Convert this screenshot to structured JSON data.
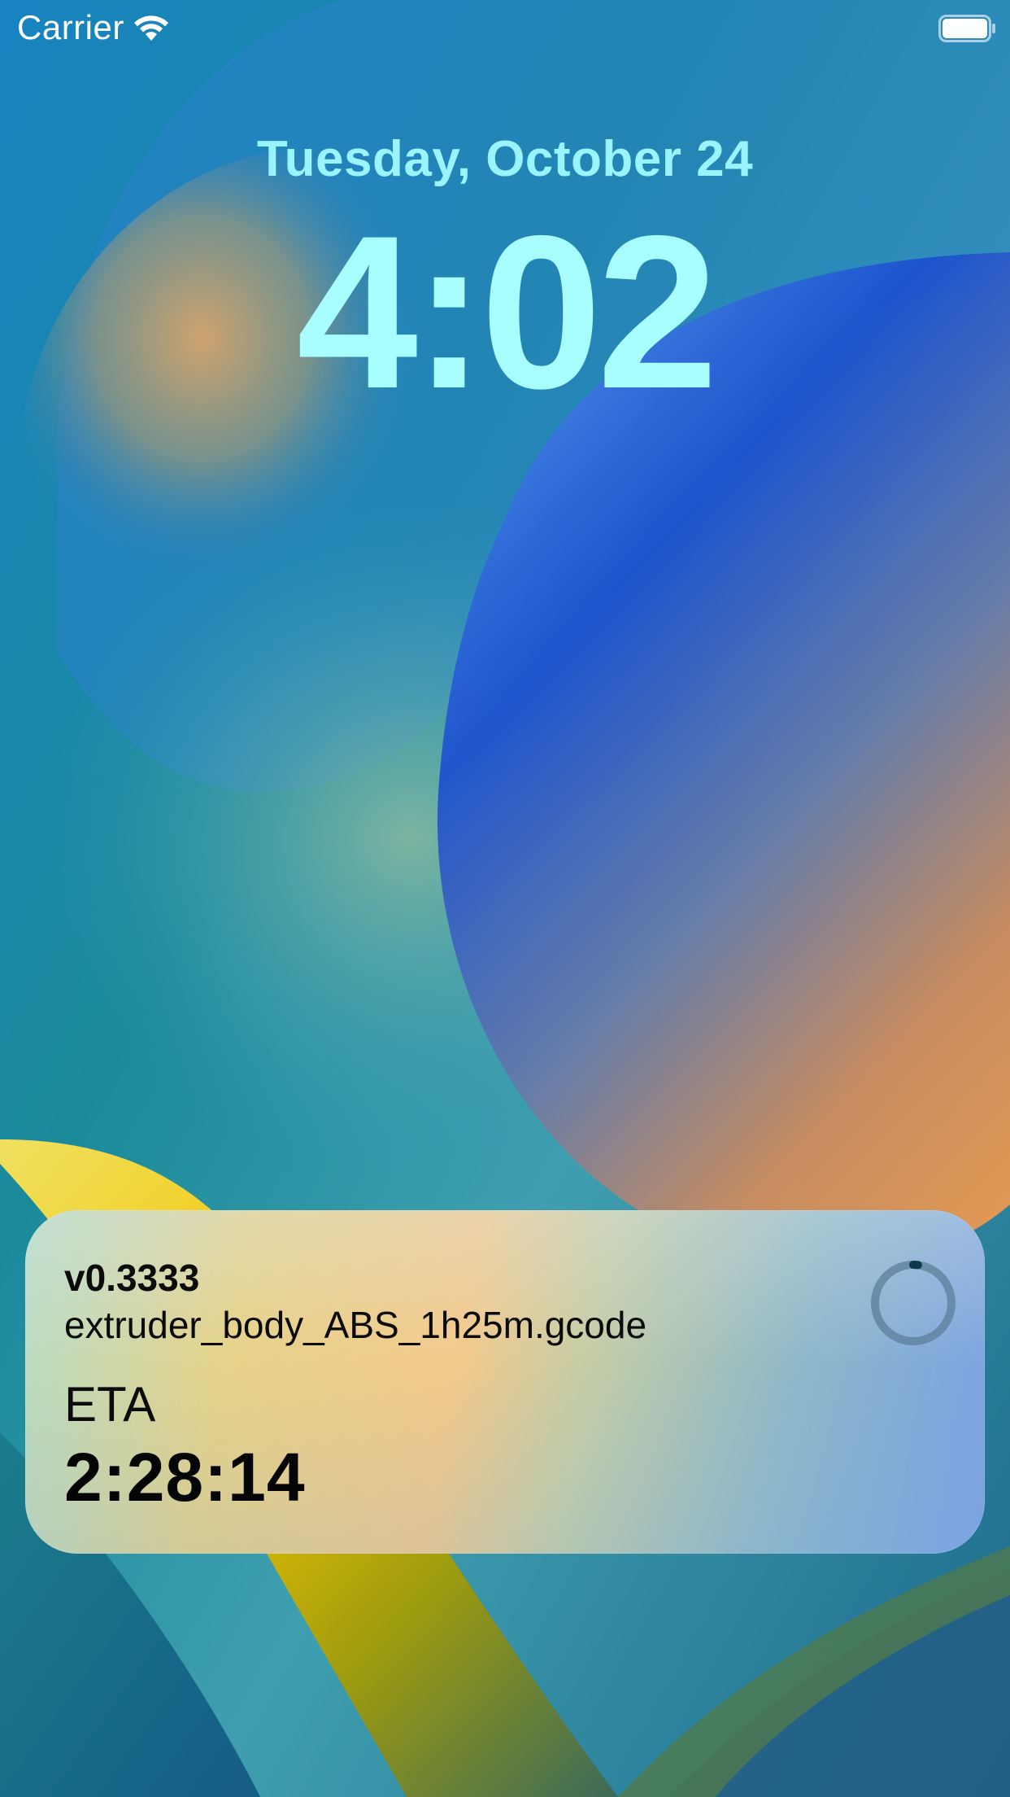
{
  "status_bar": {
    "carrier": "Carrier",
    "wifi_icon": "wifi-icon",
    "battery_icon": "battery-icon"
  },
  "lock_screen": {
    "date": "Tuesday, October 24",
    "time": "4:02"
  },
  "live_activity": {
    "version": "v0.3333",
    "filename": "extruder_body_ABS_1h25m.gcode",
    "eta_label": "ETA",
    "eta_value": "2:28:14",
    "progress": 0.02,
    "progress_icon": "progress-ring-icon"
  },
  "colors": {
    "date_text": "#9af4ff",
    "time_text": "#a8fdff",
    "progress_track": "#5b7f9a",
    "progress_fill": "#0b3a4e"
  }
}
